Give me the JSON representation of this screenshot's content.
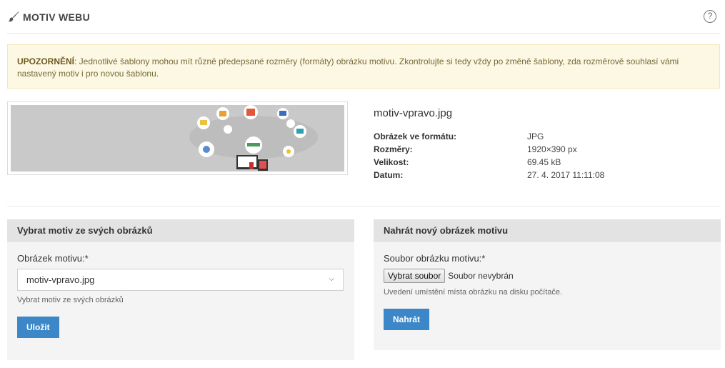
{
  "header": {
    "title": "MOTIV WEBU",
    "help_icon": "?"
  },
  "alert": {
    "strong": "UPOZORNĚNÍ",
    "text": ": Jednotlivé šablony mohou mít různě předepsané rozměry (formáty) obrázku motivu. Zkontrolujte si tedy vždy po změně šablony, zda rozměrově souhlasí vámi nastavený motiv i pro novou šablonu."
  },
  "current": {
    "filename": "motiv-vpravo.jpg",
    "rows": [
      {
        "key": "Obrázek ve formátu:",
        "value": "JPG"
      },
      {
        "key": "Rozměry:",
        "value": "1920×390 px"
      },
      {
        "key": "Velikost:",
        "value": "69.45 kB"
      },
      {
        "key": "Datum:",
        "value": "27. 4. 2017 11:11:08"
      }
    ]
  },
  "choose": {
    "heading": "Vybrat motiv ze svých obrázků",
    "label": "Obrázek motivu:*",
    "selected": "motiv-vpravo.jpg",
    "hint": "Vybrat motiv ze svých obrázků",
    "save": "Uložit"
  },
  "upload": {
    "heading": "Nahrát nový obrázek motivu",
    "label": "Soubor obrázku motivu:*",
    "file_button": "Vybrat soubor",
    "file_status": "Soubor nevybrán",
    "hint": "Uvedení umístění místa obrázku na disku počítače.",
    "submit": "Nahrát"
  },
  "colors": {
    "accent": "#3b87c8",
    "alert_bg": "#fcf8e3",
    "panel_bg": "#f4f4f4"
  }
}
